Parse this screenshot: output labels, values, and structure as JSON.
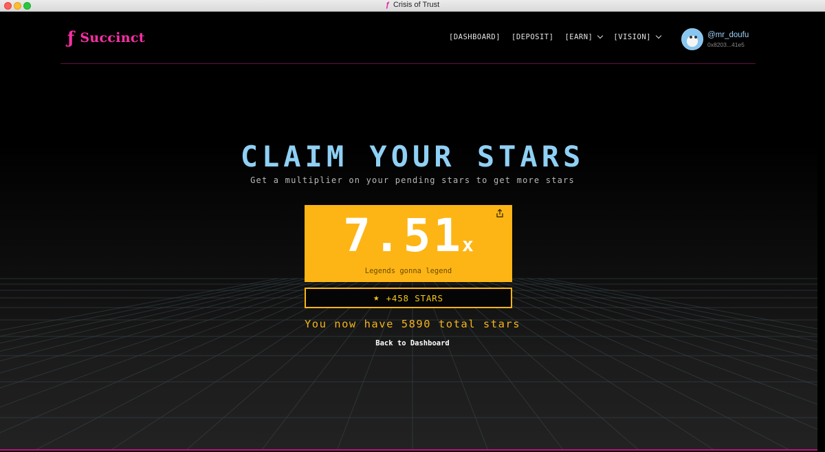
{
  "window": {
    "title": "Crisis of Trust",
    "tab_icon": "succinct-logo-icon"
  },
  "header": {
    "logo_text": "Succinct",
    "nav": [
      {
        "label": "[DASHBOARD]"
      },
      {
        "label": "[DEPOSIT]"
      },
      {
        "label": "[EARN]",
        "has_dropdown": true
      },
      {
        "label": "[VISION]",
        "has_dropdown": true
      }
    ],
    "user": {
      "name": "@mr_doufu",
      "address": "0x8203...41e5"
    }
  },
  "hero": {
    "title": "CLAIM YOUR STARS",
    "subtitle": "Get a multiplier on your pending stars to get more stars"
  },
  "multiplier": {
    "value": "7.51",
    "suffix": "x",
    "tagline": "Legends gonna legend"
  },
  "stars": {
    "label": "+458 STARS",
    "icon": "star-icon"
  },
  "total": {
    "text": "You now have 5890 total stars"
  },
  "back": {
    "label": "Back to Dashboard"
  },
  "colors": {
    "accent_pink": "#ff2fa8",
    "title_blue": "#8fd0f4",
    "card_yellow": "#fdb515",
    "star_gold": "#f5c518"
  }
}
